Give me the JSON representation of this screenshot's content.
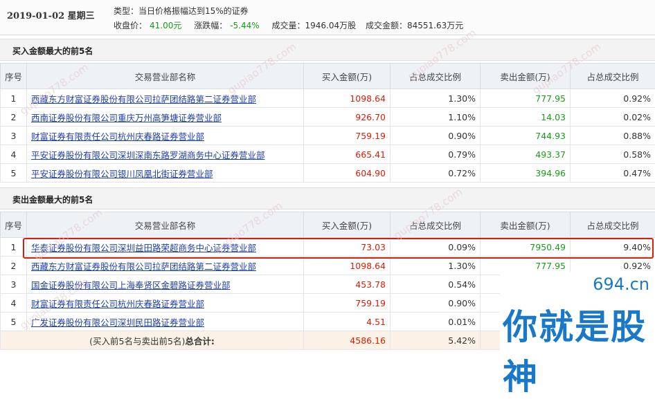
{
  "header": {
    "date": "2019-01-02 星期三",
    "type": "类型：当日价格振幅达到15%的证券",
    "close_label": "收盘价：",
    "close_value": "41.00元",
    "change_label": "涨跌幅：",
    "change_value": "-5.44%",
    "volume": "成交量：1946.04万股",
    "turnover": "成交金额：84551.63万元"
  },
  "buy_section": {
    "title": "买入金额最大的前5名",
    "columns": [
      "序号",
      "交易营业部名称",
      "买入金额(万)",
      "占总成交比例",
      "卖出金额(万)",
      "占总成交比例"
    ],
    "rows": [
      {
        "idx": "1",
        "name": "西藏东方财富证券股份有限公司拉萨团结路第二证券营业部",
        "buy": "1098.64",
        "buy_pct": "1.30%",
        "sell": "777.95",
        "sell_pct": "0.92%"
      },
      {
        "idx": "2",
        "name": "西南证券股份有限公司重庆万州高笋塘证券营业部",
        "buy": "926.70",
        "buy_pct": "1.10%",
        "sell": "14.03",
        "sell_pct": "0.02%"
      },
      {
        "idx": "3",
        "name": "财富证券有限责任公司杭州庆春路证券营业部",
        "buy": "759.19",
        "buy_pct": "0.90%",
        "sell": "744.93",
        "sell_pct": "0.88%"
      },
      {
        "idx": "4",
        "name": "平安证券股份有限公司深圳深南东路罗湖商务中心证券营业部",
        "buy": "665.41",
        "buy_pct": "0.79%",
        "sell": "493.37",
        "sell_pct": "0.58%"
      },
      {
        "idx": "5",
        "name": "平安证券股份有限公司银川凤凰北街证券营业部",
        "buy": "604.90",
        "buy_pct": "0.72%",
        "sell": "394.96",
        "sell_pct": "0.47%"
      }
    ]
  },
  "sell_section": {
    "title": "卖出金额最大的前5名",
    "columns": [
      "序号",
      "交易营业部名称",
      "买入金额(万)",
      "占总成交比例",
      "卖出金额(万)",
      "占总成交比例"
    ],
    "rows": [
      {
        "idx": "1",
        "name": "华泰证券股份有限公司深圳益田路荣超商务中心证券营业部",
        "buy": "73.03",
        "buy_pct": "0.09%",
        "sell": "7950.49",
        "sell_pct": "9.40%"
      },
      {
        "idx": "2",
        "name": "西藏东方财富证券股份有限公司拉萨团结路第二证券营业部",
        "buy": "1098.64",
        "buy_pct": "1.30%",
        "sell": "777.95",
        "sell_pct": "0.92%"
      },
      {
        "idx": "3",
        "name": "国金证券股份有限公司上海奉贤区金碧路证券营业部",
        "buy": "453.78",
        "buy_pct": "0.54%",
        "sell": "",
        "sell_pct": ""
      },
      {
        "idx": "4",
        "name": "财富证券有限责任公司杭州庆春路证券营业部",
        "buy": "759.19",
        "buy_pct": "0.90%",
        "sell": "",
        "sell_pct": ""
      },
      {
        "idx": "5",
        "name": "广发证券股份有限公司深圳民田路证券营业部",
        "buy": "4.51",
        "buy_pct": "0.01%",
        "sell": "",
        "sell_pct": ""
      }
    ],
    "total": {
      "label_prefix": "(买入前5名与卖出前5名)",
      "label_bold": "总合计:",
      "buy": "4586.16",
      "buy_pct": "5.42%"
    }
  },
  "watermark": "gupiao778.com",
  "badge": {
    "url": "694.cn",
    "text": "你就是股神"
  },
  "colors": {
    "up": "#d81e06",
    "down": "#1a9c1a",
    "link": "#1d3fa8",
    "badge": "#1978c8"
  }
}
